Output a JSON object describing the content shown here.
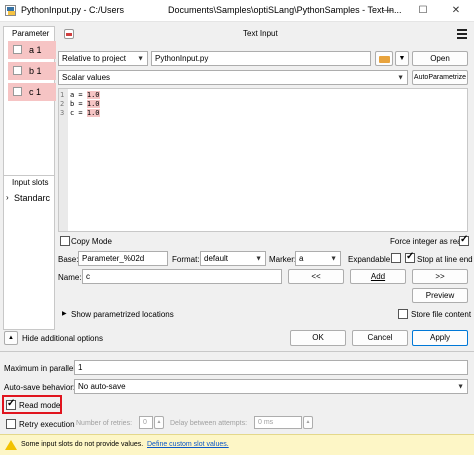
{
  "window": {
    "title_left": "PythonInput.py - C:/Users",
    "title_right": "Documents\\Samples\\optiSLang\\PythonSamples - Text In...",
    "minimize": "—",
    "maximize": "☐",
    "close": "✕"
  },
  "parameters": {
    "header": "Parameter",
    "items": [
      {
        "label": "a  1"
      },
      {
        "label": "b  1"
      },
      {
        "label": "c  1"
      }
    ]
  },
  "input_slots": {
    "header": "Input slots",
    "item": "Standarc"
  },
  "text_input": {
    "title": "Text Input",
    "path_mode": "Relative to project",
    "file": "PythonInput.py",
    "open_label": "Open",
    "value_mode": "Scalar values",
    "autoparam_label": "AutoParametrize",
    "code_lines": [
      {
        "num": "1",
        "pre": "a = ",
        "val": "1.0"
      },
      {
        "num": "2",
        "pre": "b = ",
        "val": "1.0"
      },
      {
        "num": "3",
        "pre": "c = ",
        "val": "1.0"
      }
    ],
    "copy_mode": "Copy Mode",
    "force_integer": "Force integer as real",
    "base_label": "Base:",
    "base_value": "Parameter_%02d",
    "format_label": "Format:",
    "format_value": "default",
    "marker_label": "Marker:",
    "marker_value": "a",
    "expandable": "Expandable",
    "stop_line_end": "Stop at line end",
    "name_label": "Name:",
    "name_value": "c",
    "prev_label": "<<",
    "add_label": "Add",
    "next_label": ">>",
    "preview_label": "Preview",
    "show_locations": "Show parametrized locations",
    "store_file": "Store file content"
  },
  "footer": {
    "hide_additional": "Hide additional options",
    "ok": "OK",
    "cancel": "Cancel",
    "apply": "Apply",
    "max_parallel_label": "Maximum in parallel:",
    "max_parallel_value": "1",
    "autosave_label": "Auto-save behavior:",
    "autosave_value": "No auto-save",
    "read_mode": "Read mode",
    "retry_exec": "Retry execution",
    "retries_label": "Number of retries:",
    "retries_value": "0",
    "delay_label": "Delay between attempts:",
    "delay_value": "0 ms",
    "warning_text": "Some input slots do not provide values.",
    "warning_link": "Define custom slot values."
  },
  "colors": {
    "highlight_red": "#e0141e",
    "param_bg": "#f6c4c4",
    "apply_border": "#0078d7",
    "warning_bg": "#fdf6c6"
  }
}
